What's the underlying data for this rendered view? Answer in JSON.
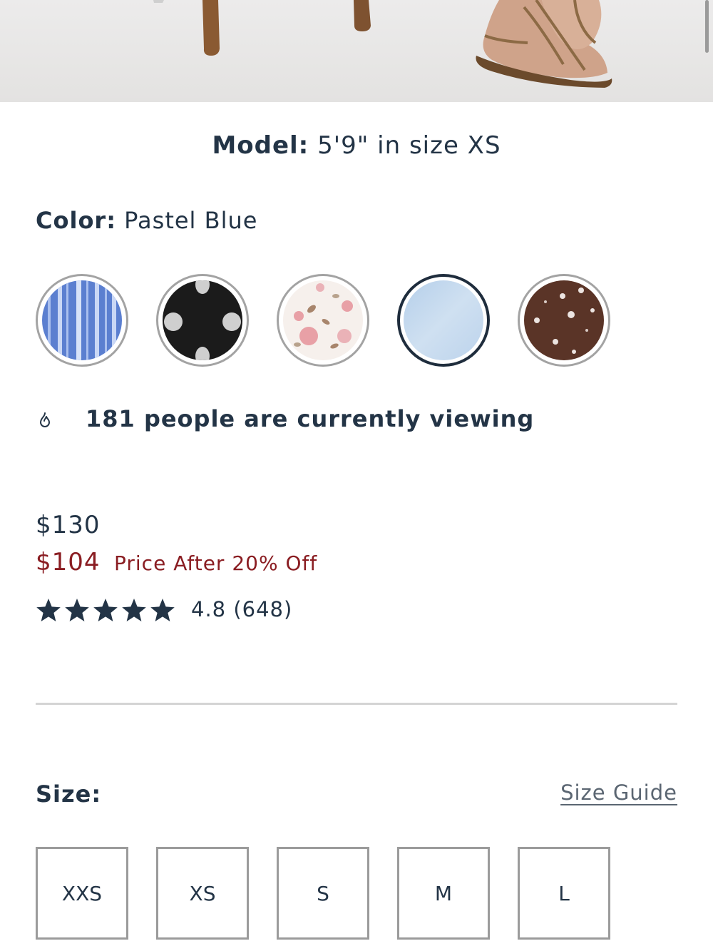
{
  "model": {
    "label": "Model:",
    "value": "5'9\" in size XS"
  },
  "color": {
    "label": "Color:",
    "selected": "Pastel Blue",
    "swatches": [
      {
        "pattern": "blue-stripe",
        "colors": [
          "#5b7fd0",
          "#a9bfee"
        ]
      },
      {
        "pattern": "black-polka-dot",
        "colors": [
          "#1b1b1b",
          "#cfcfcf"
        ]
      },
      {
        "pattern": "pink-floral",
        "colors": [
          "#f6f0ec",
          "#e8a0a6",
          "#a8856c"
        ]
      },
      {
        "pattern": "pastel-blue-solid",
        "colors": [
          "#c2d8ee"
        ],
        "selected": true
      },
      {
        "pattern": "brown-floral",
        "colors": [
          "#5a3427",
          "#ece4e1"
        ]
      }
    ]
  },
  "viewing": {
    "icon": "flame-icon",
    "text": "181 people are currently viewing"
  },
  "pricing": {
    "original": "$130",
    "sale": "$104",
    "sale_note": "Price After 20% Off",
    "sale_color": "#8a1d22"
  },
  "rating": {
    "stars": 5,
    "text": "4.8 (648)"
  },
  "size": {
    "label": "Size:",
    "guide_link": "Size Guide",
    "options": [
      "XXS",
      "XS",
      "S",
      "M",
      "L"
    ]
  }
}
